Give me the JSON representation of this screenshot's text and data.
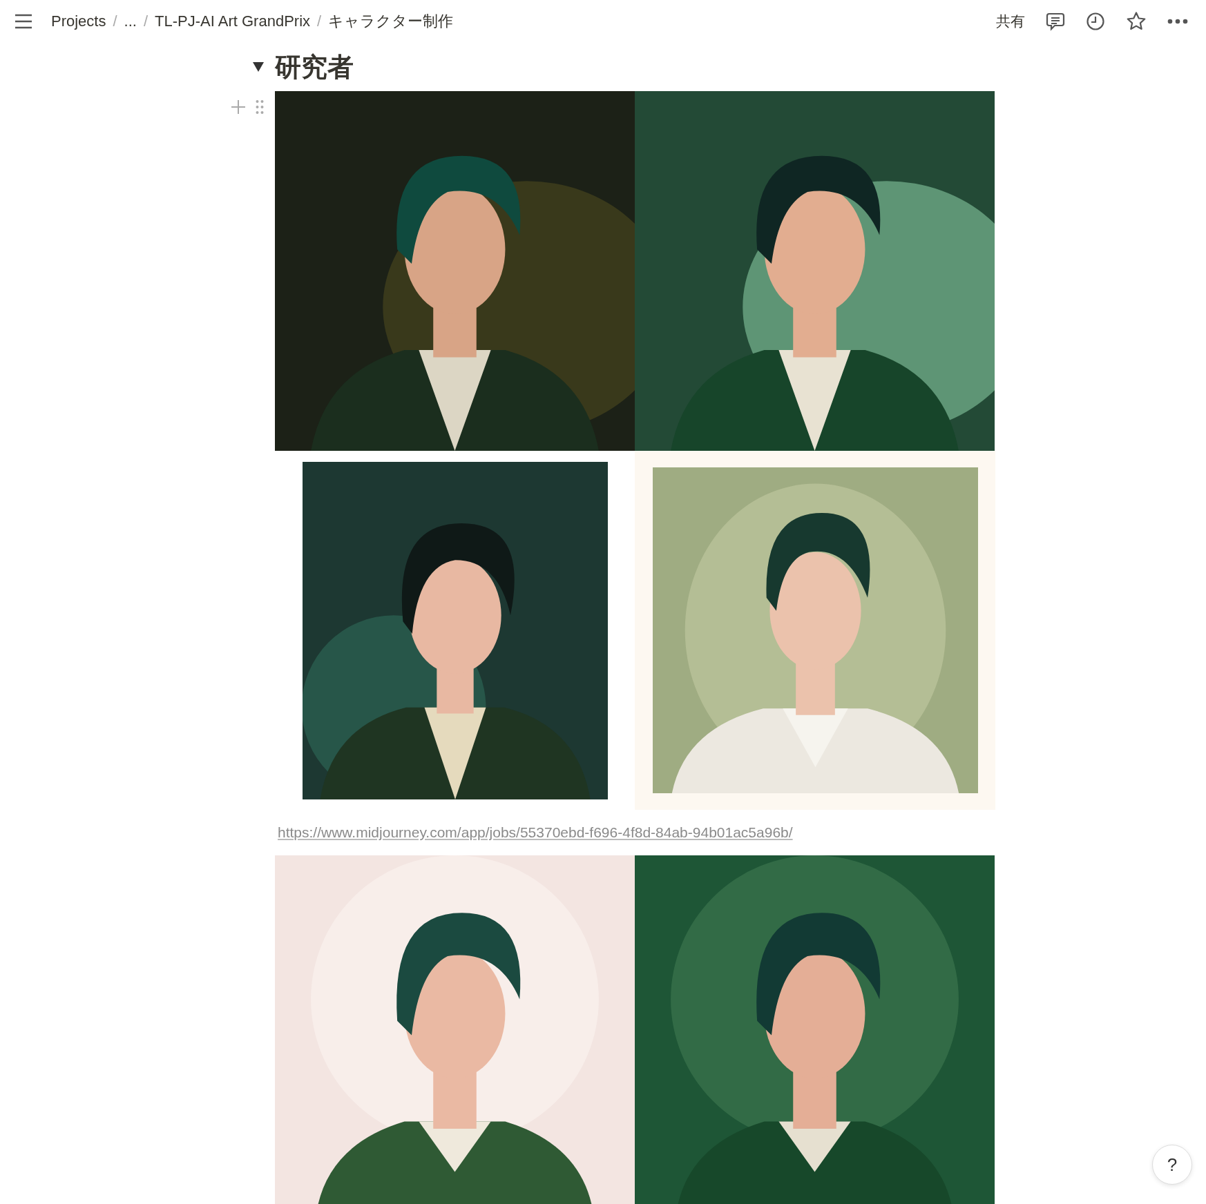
{
  "breadcrumb": [
    {
      "label": "Projects",
      "separator": "/"
    },
    {
      "label": "...",
      "separator": "/"
    },
    {
      "label": "TL-PJ-AI Art GrandPrix",
      "separator": "/"
    },
    {
      "label": "キャラクター制作"
    }
  ],
  "share": "共有",
  "toggle": {
    "title": "研究者",
    "expanded": true
  },
  "link": "https://www.midjourney.com/app/jobs/55370ebd-f696-4f8d-84ab-94b01ac5a96b/",
  "help": "?"
}
